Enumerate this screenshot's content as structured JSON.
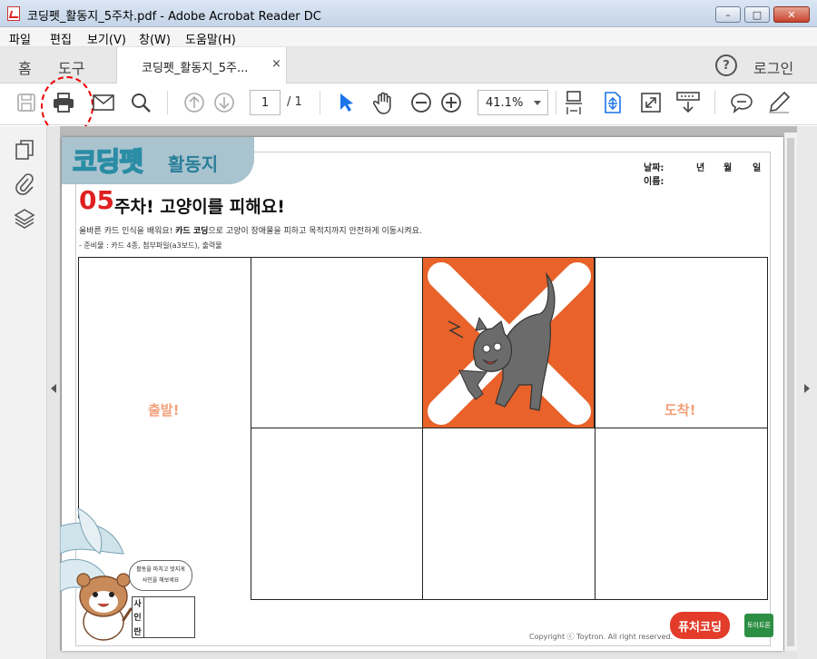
{
  "window": {
    "title": "코딩펫_활동지_5주차.pdf - Adobe Acrobat Reader DC",
    "min_glyph": "–",
    "max_glyph": "□",
    "close_glyph": "✕"
  },
  "menu": [
    "파일",
    "편집",
    "보기(V)",
    "창(W)",
    "도움말(H)"
  ],
  "tabs": {
    "home": "홈",
    "tools": "도구",
    "document": "코딩펫_활동지_5주...",
    "close": "×",
    "help": "?",
    "login": "로그인"
  },
  "toolbar": {
    "page_current": "1",
    "page_total": "/ 1",
    "zoom": "41.1%"
  },
  "colors": {
    "accent_blue": "#1a73e8",
    "print_highlight": "#e00000",
    "cat_cell": "#e8622a",
    "cell_label": "#f3a07a"
  },
  "worksheet": {
    "logo": "코딩펫",
    "logo_sub": "활동지",
    "date_label": "날짜:",
    "name_label": "이름:",
    "year": "년",
    "month": "월",
    "day": "일",
    "week_number": "05",
    "week_title": "주차! 고양이를 피해요!",
    "desc_pre": "올바른 카드 인식을 배워요! ",
    "desc_bold": "카드 코딩",
    "desc_post": "으로 고양이 장애물을 피하고 목적지까지 안전하게 이동시켜요.",
    "prep": "- 준비물 : 카드 4종, 첨부파일(a3보드), 출력물",
    "start_label": "출발!",
    "end_label": "도착!",
    "speech": [
      "활동을 마치고 멋지게",
      "사인을 해보세요"
    ],
    "sign_chars": [
      "사",
      "인",
      "란"
    ],
    "copyright": "Copyright ⓒ Toytron. All right reserved.",
    "brand": "퓨처코딩",
    "brand2": "토이트론"
  }
}
